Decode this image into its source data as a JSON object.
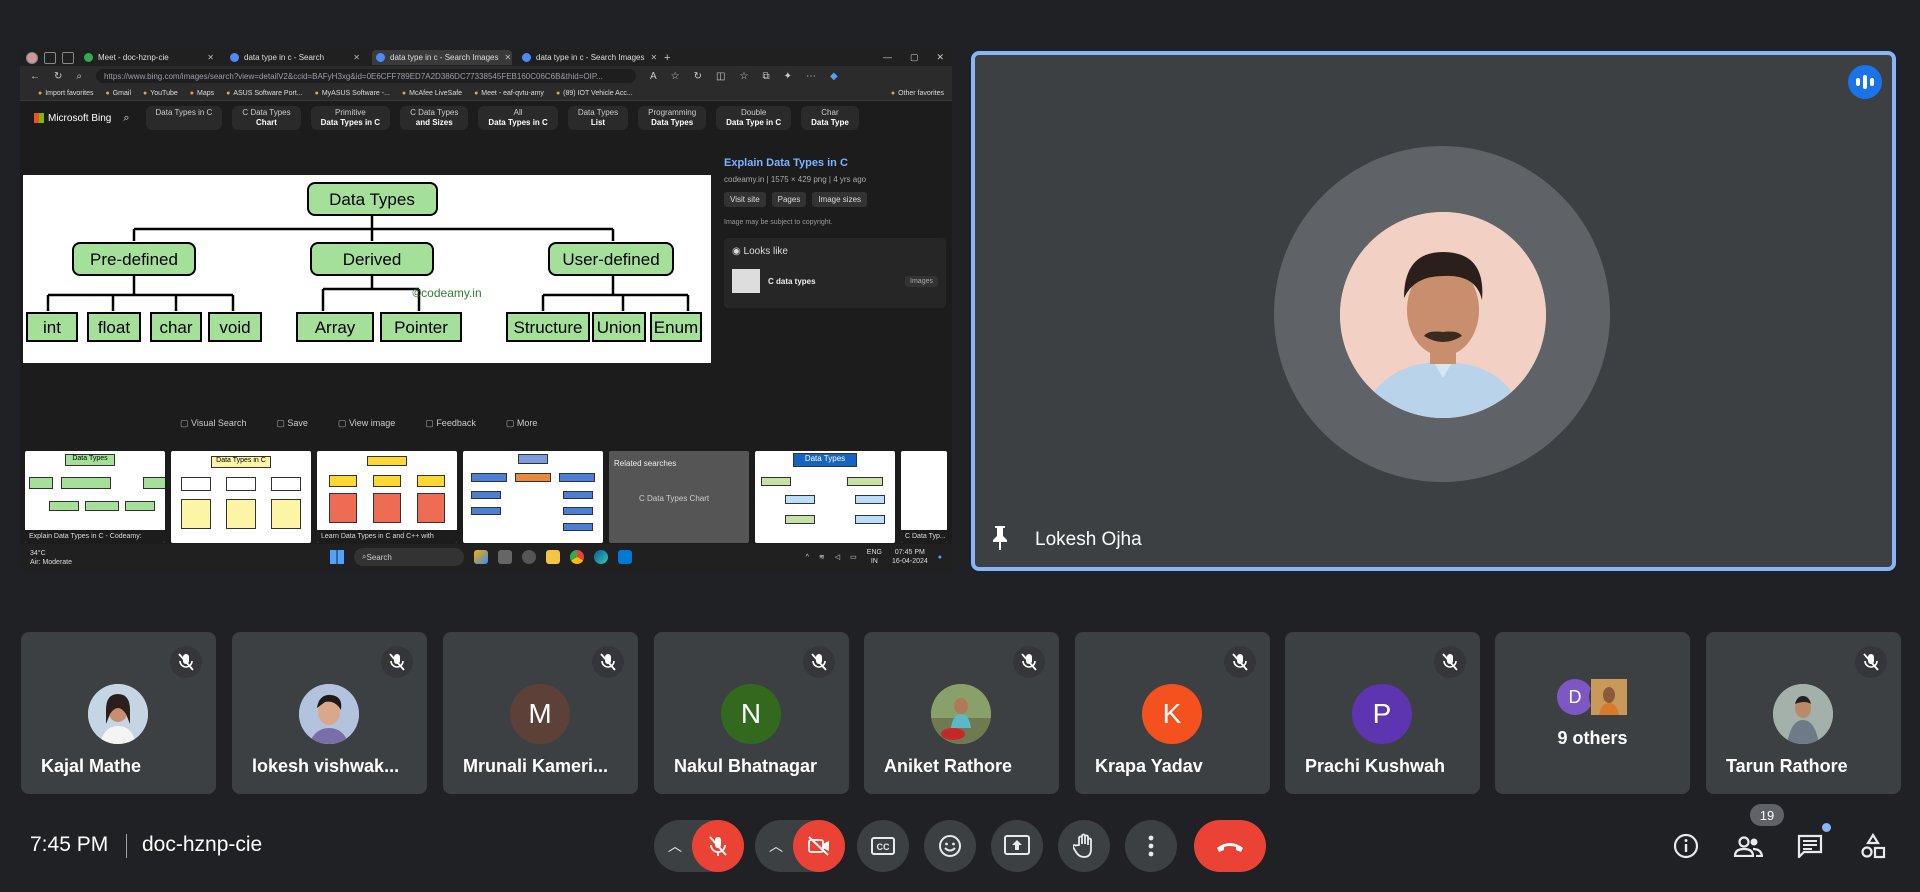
{
  "browser": {
    "tabs": [
      {
        "label": "Meet - doc-hznp-cie",
        "color": "#34a853"
      },
      {
        "label": "data type in c - Search",
        "color": "#4c8bf5"
      },
      {
        "label": "data type in c - Search Images",
        "color": "#4c8bf5"
      },
      {
        "label": "data type in c - Search Images",
        "color": "#4c8bf5"
      }
    ],
    "url": "https://www.bing.com/images/search?view=detailV2&ccid=BAFyH3xg&id=0E6CFF789ED7A2D386DC77338545FEB160C06C6B&thid=OIP...",
    "favorites": [
      "Import favorites",
      "Gmail",
      "YouTube",
      "Maps",
      "ASUS Software Port...",
      "MyASUS Software -...",
      "McAfee LiveSafe",
      "Meet - eaf-qvtu-amy",
      "(89) IOT Vehicle Acc..."
    ],
    "other_favorites": "Other favorites",
    "bing_logo": "Microsoft Bing",
    "chips": [
      {
        "top": "Data Types in C",
        "bottom": ""
      },
      {
        "top": "C Data Types",
        "bottom": "Chart"
      },
      {
        "top": "Primitive",
        "bottom": "Data Types in C"
      },
      {
        "top": "C Data Types",
        "bottom": "and Sizes"
      },
      {
        "top": "All",
        "bottom": "Data Types in C"
      },
      {
        "top": "Data Types",
        "bottom": "List"
      },
      {
        "top": "Programming",
        "bottom": "Data Types"
      },
      {
        "top": "Double",
        "bottom": "Data Type in C"
      },
      {
        "top": "Char",
        "bottom": "Data Type"
      }
    ],
    "diagram": {
      "root": "Data Types",
      "branches": [
        "Pre-defined",
        "Derived",
        "User-defined"
      ],
      "predefined": [
        "int",
        "float",
        "char",
        "void"
      ],
      "derived": [
        "Array",
        "Pointer"
      ],
      "userdefined": [
        "Structure",
        "Union",
        "Enum"
      ],
      "watermark": "©codeamy.in"
    },
    "side": {
      "title": "Explain Data Types in C",
      "meta": "codeamy.in  |  1575 × 429 png  |  4 yrs ago",
      "buttons": [
        "Visit site",
        "Pages",
        "Image sizes"
      ],
      "copyright": "Image may be subject to copyright.",
      "looks_like": "Looks like",
      "looks_item": "C data types",
      "looks_tag": "Images"
    },
    "actions": [
      "Visual Search",
      "Save",
      "View image",
      "Feedback",
      "More"
    ],
    "thumb_captions": [
      "Explain Data Types in C - Codeamy:",
      "",
      "Learn Data Types in C and C++ with",
      "",
      "",
      "",
      "C Data Typ..."
    ],
    "related_title": "Related searches",
    "related_item": "C Data Types Chart",
    "thumb_labels": {
      "t1": "Data Types",
      "t2": "Data Types in C",
      "t6": "Data Types"
    },
    "taskbar": {
      "temp": "34°C",
      "air": "Air: Moderate",
      "search": "Search",
      "lang1": "ENG",
      "lang2": "IN",
      "clock": "07:45 PM",
      "date": "16-04-2024"
    }
  },
  "speaker": {
    "name": "Lokesh Ojha"
  },
  "participants": [
    {
      "name": "Kajal Mathe",
      "initial": "",
      "color": "#b8c9d9"
    },
    {
      "name": "lokesh vishwak...",
      "initial": "",
      "color": "#a7b7d2"
    },
    {
      "name": "Mrunali Kameri...",
      "initial": "M",
      "color": "#5d4037"
    },
    {
      "name": "Nakul Bhatnagar",
      "initial": "N",
      "color": "#33691e"
    },
    {
      "name": "Aniket Rathore",
      "initial": "",
      "color": "#7b8c5a"
    },
    {
      "name": "Krapa Yadav",
      "initial": "K",
      "color": "#f4511e"
    },
    {
      "name": "Prachi Kushwah",
      "initial": "P",
      "color": "#5e35b1"
    },
    {
      "name": "Tarun Rathore",
      "initial": "",
      "color": "#9aa7a0"
    }
  ],
  "others": {
    "label": "9 others",
    "initial": "D",
    "color": "#7e57c2"
  },
  "bottom": {
    "time": "7:45 PM",
    "meeting_code": "doc-hznp-cie",
    "participant_count": "19"
  }
}
